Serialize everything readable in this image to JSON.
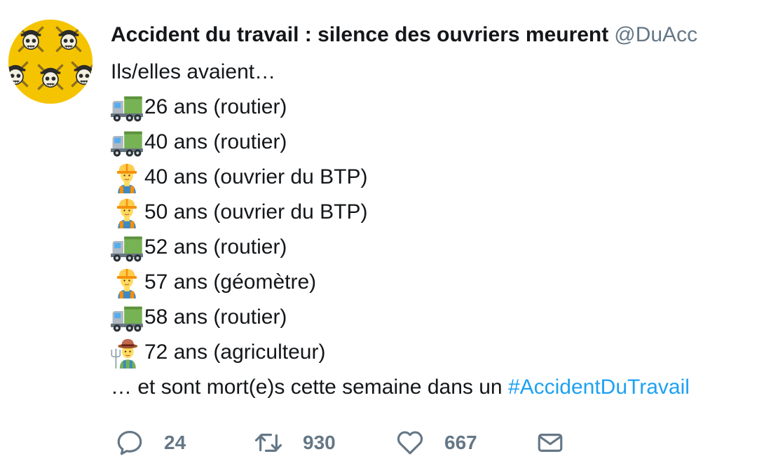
{
  "tweet": {
    "display_name": "Accident du travail : silence des ouvriers meurent",
    "handle": "@DuAcc",
    "intro": "Ils/elles avaient…",
    "items": [
      {
        "emoji": "truck-icon",
        "text": "26 ans (routier)"
      },
      {
        "emoji": "truck-icon",
        "text": "40 ans (routier)"
      },
      {
        "emoji": "construction-worker-icon",
        "text": "40 ans (ouvrier du BTP)"
      },
      {
        "emoji": "construction-worker-icon",
        "text": "50 ans (ouvrier du BTP)"
      },
      {
        "emoji": "truck-icon",
        "text": "52 ans (routier)"
      },
      {
        "emoji": "construction-worker-icon",
        "text": "57 ans (géomètre)"
      },
      {
        "emoji": "truck-icon",
        "text": "58 ans (routier)"
      },
      {
        "emoji": "farmer-icon",
        "text": "72 ans (agriculteur)"
      }
    ],
    "closing_text": "… et sont mort(e)s cette semaine dans un ",
    "hashtag": "#AccidentDuTravail"
  },
  "actions": {
    "reply_count": "24",
    "retweet_count": "930",
    "like_count": "667"
  },
  "colors": {
    "text": "#14171a",
    "secondary": "#657786",
    "link": "#1da1f2",
    "avatar_bg": "#f5c400"
  }
}
